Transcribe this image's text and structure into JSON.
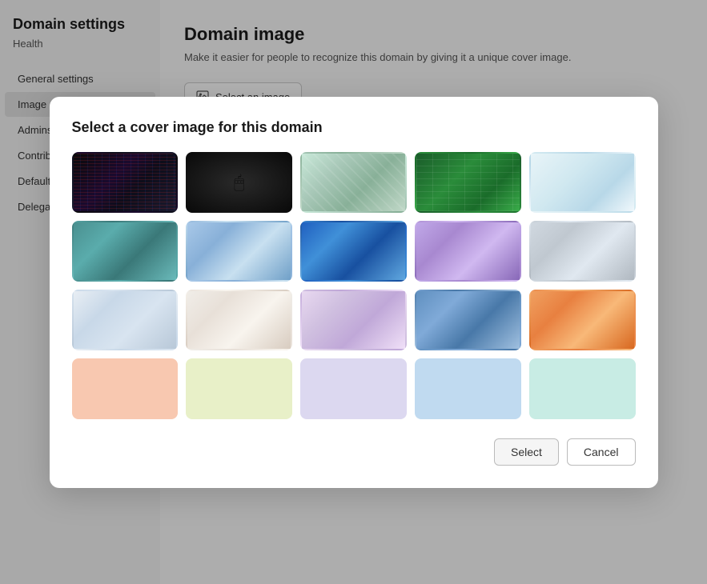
{
  "sidebar": {
    "title": "Domain settings",
    "subtitle": "Health",
    "items": [
      {
        "id": "general-settings",
        "label": "General settings",
        "active": false
      },
      {
        "id": "image",
        "label": "Image",
        "active": true
      },
      {
        "id": "admins",
        "label": "Admins",
        "active": false
      },
      {
        "id": "contributors",
        "label": "Contributors",
        "active": false
      },
      {
        "id": "default-domain",
        "label": "Default doma…",
        "active": false
      },
      {
        "id": "delegated-settings",
        "label": "Delegated Se…",
        "active": false
      }
    ]
  },
  "main": {
    "title": "Domain image",
    "description": "Make it easier for people to recognize this domain by giving it a unique cover image.",
    "select_image_label": "Select an image"
  },
  "modal": {
    "title": "Select a cover image for this domain",
    "images": [
      {
        "id": "dark-code",
        "alt": "Dark code background",
        "css_class": "img-dark-code"
      },
      {
        "id": "dark-mouse",
        "alt": "Dark mouse",
        "css_class": "img-dark-mouse"
      },
      {
        "id": "tech-chips",
        "alt": "Tech chips",
        "css_class": "img-tech-chips"
      },
      {
        "id": "green-spreadsheet",
        "alt": "Green spreadsheet",
        "css_class": "img-green-spreadsheet"
      },
      {
        "id": "notebook",
        "alt": "Notebook",
        "css_class": "img-notebook"
      },
      {
        "id": "teal-blocks",
        "alt": "Teal 3D blocks",
        "css_class": "img-teal-blocks"
      },
      {
        "id": "glass-cubes",
        "alt": "Glass cubes",
        "css_class": "img-glass-cubes"
      },
      {
        "id": "tablet-ui",
        "alt": "Tablet UI",
        "css_class": "img-tablet-ui"
      },
      {
        "id": "purple-papers",
        "alt": "Purple floating papers",
        "css_class": "img-purple-papers"
      },
      {
        "id": "3d-room",
        "alt": "3D room",
        "css_class": "img-3d-room"
      },
      {
        "id": "stack-papers",
        "alt": "Stack of papers",
        "css_class": "img-stack-papers"
      },
      {
        "id": "desk-plant",
        "alt": "Desk with plant",
        "css_class": "img-desk-plant"
      },
      {
        "id": "laptop-purple",
        "alt": "Laptop purple",
        "css_class": "img-laptop-purple"
      },
      {
        "id": "landscape-blue",
        "alt": "Blue landscape",
        "css_class": "img-landscape-blue"
      },
      {
        "id": "orange-abstract",
        "alt": "Orange abstract",
        "css_class": "img-orange-abstract"
      }
    ],
    "swatches": [
      {
        "id": "peach",
        "css_class": "swatch-peach",
        "label": "Peach"
      },
      {
        "id": "lime",
        "css_class": "swatch-lime",
        "label": "Lime"
      },
      {
        "id": "lavender",
        "css_class": "swatch-lavender",
        "label": "Lavender"
      },
      {
        "id": "sky",
        "css_class": "swatch-sky",
        "label": "Sky blue"
      },
      {
        "id": "mint",
        "css_class": "swatch-mint",
        "label": "Mint"
      }
    ],
    "buttons": {
      "select": "Select",
      "cancel": "Cancel"
    }
  }
}
